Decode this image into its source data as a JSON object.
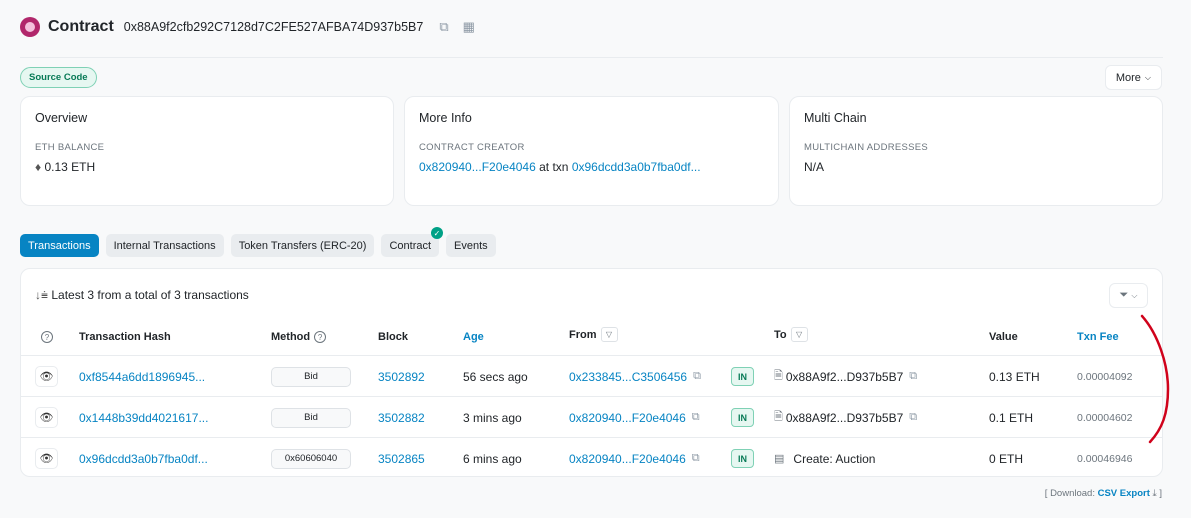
{
  "header": {
    "title": "Contract",
    "address": "0x88A9f2cfb292C7128d7C2FE527AFBA74D937b5B7"
  },
  "source_badge": "Source Code",
  "more_button": "More",
  "cards": {
    "overview": {
      "title": "Overview",
      "label": "ETH BALANCE",
      "value": "0.13 ETH",
      "icon": "eth-diamond-icon"
    },
    "more_info": {
      "title": "More Info",
      "label": "CONTRACT CREATOR",
      "creator": "0x820940...F20e4046",
      "at_txn": "at txn",
      "txn": "0x96dcdd3a0b7fba0df..."
    },
    "multi_chain": {
      "title": "Multi Chain",
      "label": "MULTICHAIN ADDRESSES",
      "value": "N/A"
    }
  },
  "tabs": [
    "Transactions",
    "Internal Transactions",
    "Token Transfers (ERC-20)",
    "Contract",
    "Events"
  ],
  "table": {
    "summary": "Latest 3 from a total of 3 transactions",
    "headers": {
      "hash": "Transaction Hash",
      "method": "Method",
      "block": "Block",
      "age": "Age",
      "from": "From",
      "to": "To",
      "value": "Value",
      "fee": "Txn Fee"
    },
    "rows": [
      {
        "hash": "0xf8544a6dd1896945...",
        "method": "Bid",
        "block": "3502892",
        "age": "56 secs ago",
        "from": "0x233845...C3506456",
        "direction": "IN",
        "to": "0x88A9f2...D937b5B7",
        "value": "0.13 ETH",
        "fee": "0.00004092"
      },
      {
        "hash": "0x1448b39dd4021617...",
        "method": "Bid",
        "block": "3502882",
        "age": "3 mins ago",
        "from": "0x820940...F20e4046",
        "direction": "IN",
        "to": "0x88A9f2...D937b5B7",
        "value": "0.1 ETH",
        "fee": "0.00004602"
      },
      {
        "hash": "0x96dcdd3a0b7fba0df...",
        "method": "0x60606040",
        "block": "3502865",
        "age": "6 mins ago",
        "from": "0x820940...F20e4046",
        "direction": "IN",
        "to": "Create: Auction",
        "value": "0 ETH",
        "fee": "0.00046946"
      }
    ]
  },
  "download": {
    "prefix": "[ Download:",
    "link": "CSV Export",
    "suffix": "]"
  },
  "colors": {
    "accent": "#0784c3",
    "success": "#00a186",
    "annotation": "#d0021b"
  }
}
